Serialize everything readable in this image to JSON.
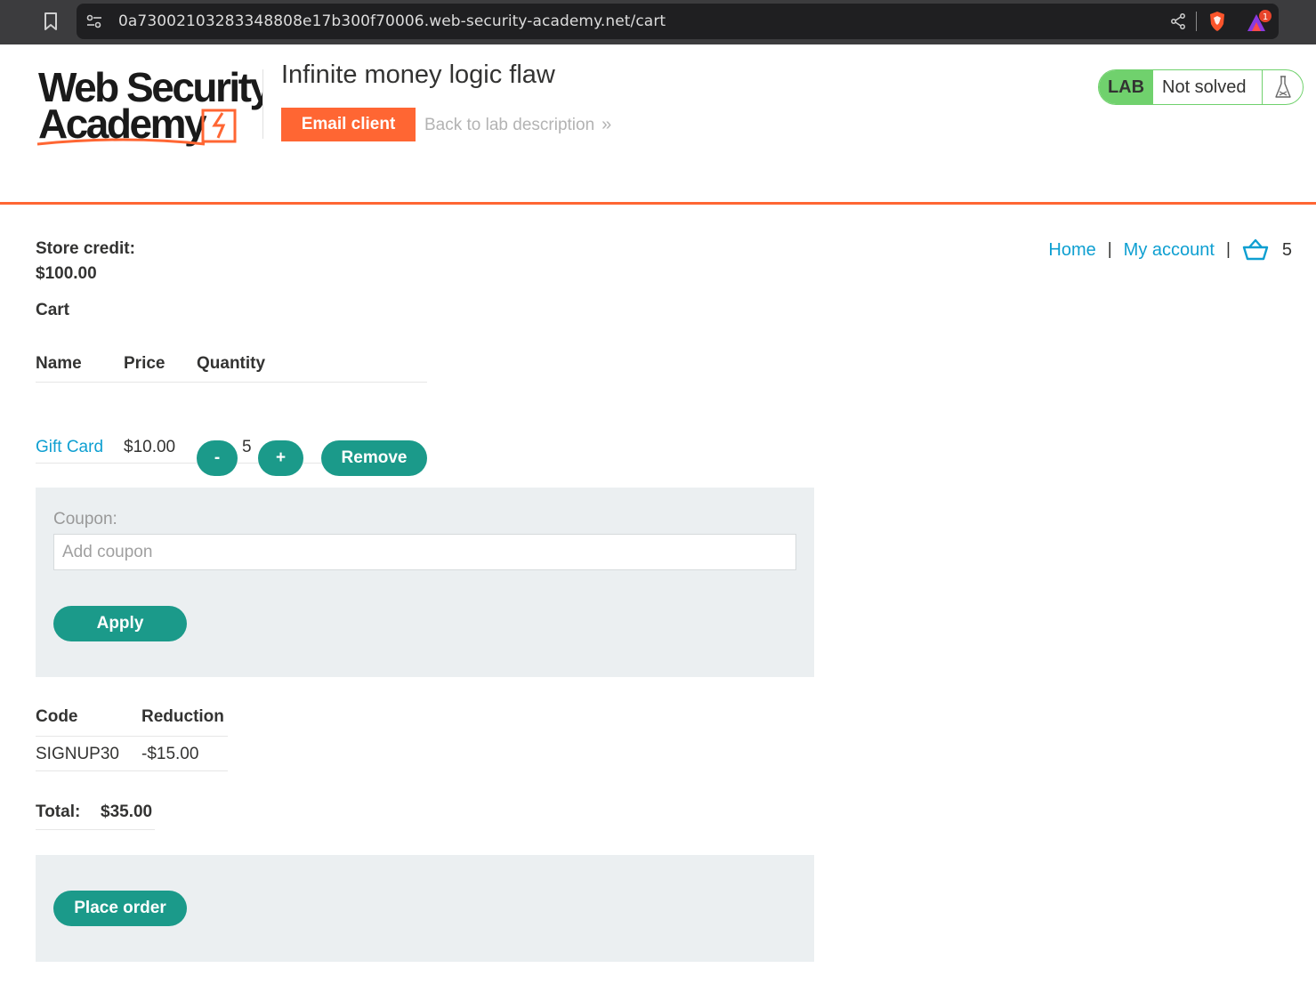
{
  "browser": {
    "url": "0a73002103283348808e17b300f70006.web-security-academy.net/cart",
    "rewards_badge": "1"
  },
  "header": {
    "logo_line1": "Web Security",
    "logo_line2": "Academy",
    "lab_title": "Infinite money logic flaw",
    "email_client_label": "Email client",
    "back_link_label": "Back to lab description",
    "back_link_chevron": "»",
    "lab_badge": "LAB",
    "lab_state": "Not solved"
  },
  "nav": {
    "home": "Home",
    "separator": "|",
    "my_account": "My account",
    "cart_count": "5"
  },
  "account": {
    "store_credit_label": "Store credit:",
    "store_credit_value": "$100.00"
  },
  "cart": {
    "heading": "Cart",
    "columns": [
      "Name",
      "Price",
      "Quantity"
    ],
    "items": [
      {
        "name": "Gift Card",
        "price": "$10.00",
        "quantity": "5",
        "minus": "-",
        "plus": "+",
        "remove": "Remove"
      }
    ]
  },
  "coupon_form": {
    "label": "Coupon:",
    "placeholder": "Add coupon",
    "value": "",
    "apply_label": "Apply"
  },
  "coupons": {
    "columns": [
      "Code",
      "Reduction"
    ],
    "rows": [
      {
        "code": "SIGNUP30",
        "reduction": "-$15.00"
      }
    ]
  },
  "total": {
    "label": "Total:",
    "value": "$35.00"
  },
  "order": {
    "place_order_label": "Place order"
  },
  "colors": {
    "brand_orange": "#ff6633",
    "link_blue": "#0e9fd1",
    "button_teal": "#1b9a8a",
    "lab_green": "#70d16d",
    "panel_gray": "#ebeff1"
  }
}
